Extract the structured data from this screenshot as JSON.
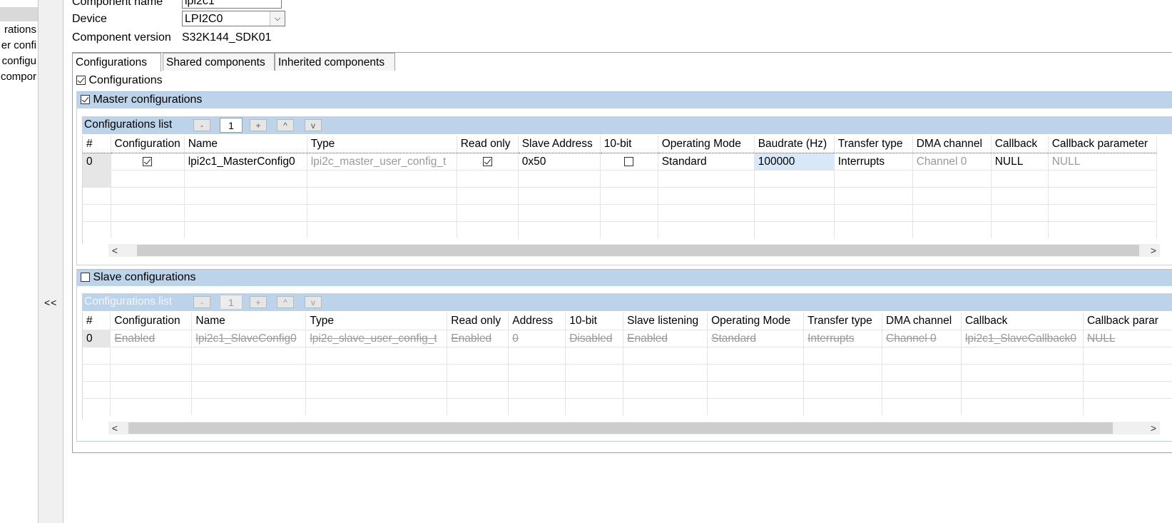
{
  "left_tree": {
    "items": [
      "rations",
      "er confi",
      "configu",
      "compor"
    ]
  },
  "splitter": {
    "collapse_label": "<<"
  },
  "properties": {
    "component_name_label": "Component name",
    "component_name_value": "lpi2c1",
    "device_label": "Device",
    "device_value": "LPI2C0",
    "component_version_label": "Component version",
    "component_version_value": "S32K144_SDK01"
  },
  "tabs": [
    {
      "label": "Configurations",
      "active": true
    },
    {
      "label": "Shared components",
      "active": false
    },
    {
      "label": "Inherited components",
      "active": false
    }
  ],
  "configurations_check": {
    "label": "Configurations",
    "checked": true
  },
  "master": {
    "group_label": "Master configurations",
    "checked": true,
    "list_title": "Configurations list",
    "minus": "-",
    "count": "1",
    "plus": "+",
    "up": "^",
    "down": "v",
    "columns": [
      "#",
      "Configuration",
      "Name",
      "Type",
      "Read only",
      "Slave Address",
      "10-bit",
      "Operating Mode",
      "Baudrate (Hz)",
      "Transfer type",
      "DMA channel",
      "Callback",
      "Callback parameter"
    ],
    "rows": [
      {
        "index": "0",
        "configuration_checked": true,
        "name": "lpi2c1_MasterConfig0",
        "type": "lpi2c_master_user_config_t",
        "read_only_checked": true,
        "slave_address": "0x50",
        "ten_bit_checked": false,
        "operating_mode": "Standard",
        "baudrate": "100000",
        "transfer_type": "Interrupts",
        "dma_channel": "Channel 0",
        "callback": "NULL",
        "callback_parameter": "NULL"
      }
    ]
  },
  "slave": {
    "group_label": "Slave configurations",
    "checked": false,
    "list_title": "Configurations list",
    "minus": "-",
    "count": "1",
    "plus": "+",
    "up": "^",
    "down": "v",
    "columns": [
      "#",
      "Configuration",
      "Name",
      "Type",
      "Read only",
      "Address",
      "10-bit",
      "Slave listening",
      "Operating Mode",
      "Transfer type",
      "DMA channel",
      "Callback",
      "Callback parar"
    ],
    "rows": [
      {
        "index": "0",
        "configuration": "Enabled",
        "name": "lpi2c1_SlaveConfig0",
        "type": "lpi2c_slave_user_config_t",
        "read_only": "Enabled",
        "address": "0",
        "ten_bit": "Disabled",
        "slave_listening": "Enabled",
        "operating_mode": "Standard",
        "transfer_type": "Interrupts",
        "dma_channel": "Channel 0",
        "callback": "lpi2c1_SlaveCallback0",
        "callback_parameter": "NULL"
      }
    ]
  },
  "scrollbar": {
    "left": "<",
    "right": ">"
  },
  "colors": {
    "group_bar": "#bcd3ea",
    "selected_cell": "#d8e8f8"
  }
}
